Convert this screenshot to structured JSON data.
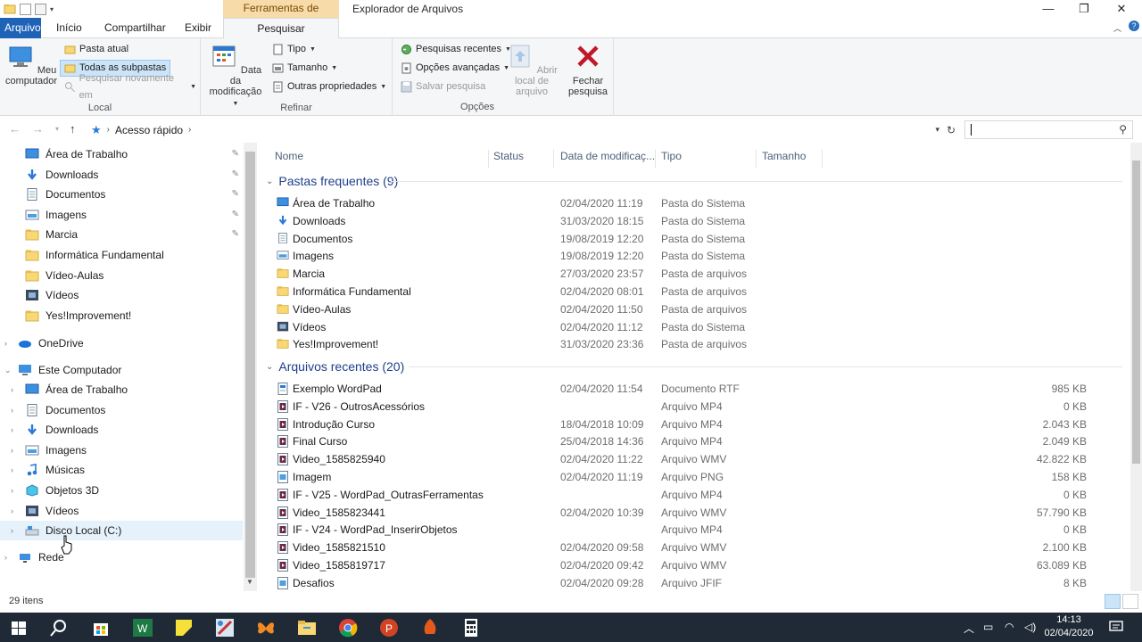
{
  "window": {
    "title": "Explorador de Arquivos",
    "context_tab": "Ferramentas de Pesquisa",
    "minimize": "—",
    "maximize": "❐",
    "close": "✕"
  },
  "tabs": [
    {
      "label": "Arquivo"
    },
    {
      "label": "Início"
    },
    {
      "label": "Compartilhar"
    },
    {
      "label": "Exibir"
    },
    {
      "label": "Pesquisar"
    }
  ],
  "ribbon": {
    "local": {
      "label": "Local",
      "computer": "Meu computador",
      "current_folder": "Pasta atual",
      "all_subfolders": "Todas as subpastas",
      "search_again": "Pesquisar novamente em"
    },
    "refine": {
      "label": "Refinar",
      "date_modified": "Data da modificação",
      "type": "Tipo",
      "size": "Tamanho",
      "other_props": "Outras propriedades"
    },
    "options": {
      "label": "Opções",
      "recent_searches": "Pesquisas recentes",
      "advanced": "Opções avançadas",
      "save_search": "Salvar pesquisa",
      "open_location": "Abrir local de arquivo",
      "close_search": "Fechar pesquisa"
    }
  },
  "address": {
    "path": "Acesso rápido",
    "search_placeholder": ""
  },
  "nav": {
    "quick_access": [
      {
        "label": "Área de Trabalho",
        "icon": "desktop-icon",
        "pinned": true
      },
      {
        "label": "Downloads",
        "icon": "download-icon",
        "pinned": true
      },
      {
        "label": "Documentos",
        "icon": "document-icon",
        "pinned": true
      },
      {
        "label": "Imagens",
        "icon": "image-icon",
        "pinned": true
      },
      {
        "label": "Marcia",
        "icon": "folder-icon",
        "pinned": true
      },
      {
        "label": "Informática Fundamental",
        "icon": "folder-icon",
        "pinned": false
      },
      {
        "label": "Vídeo-Aulas",
        "icon": "folder-icon",
        "pinned": false
      },
      {
        "label": "Vídeos",
        "icon": "video-icon",
        "pinned": false
      },
      {
        "label": "Yes!Improvement!",
        "icon": "folder-icon",
        "pinned": false
      }
    ],
    "onedrive": "OneDrive",
    "this_pc": "Este Computador",
    "pc_items": [
      {
        "label": "Área de Trabalho",
        "icon": "desktop-icon"
      },
      {
        "label": "Documentos",
        "icon": "document-icon"
      },
      {
        "label": "Downloads",
        "icon": "download-icon"
      },
      {
        "label": "Imagens",
        "icon": "image-icon"
      },
      {
        "label": "Músicas",
        "icon": "music-icon"
      },
      {
        "label": "Objetos 3D",
        "icon": "3d-icon"
      },
      {
        "label": "Vídeos",
        "icon": "video-icon"
      },
      {
        "label": "Disco Local (C:)",
        "icon": "drive-icon"
      }
    ],
    "network": "Rede"
  },
  "columns": {
    "name": "Nome",
    "status": "Status",
    "date": "Data de modificaç...",
    "type": "Tipo",
    "size": "Tamanho"
  },
  "groups": {
    "frequent": "Pastas frequentes (9)",
    "recent": "Arquivos recentes (20)"
  },
  "frequent_folders": [
    {
      "name": "Área de Trabalho",
      "date": "02/04/2020 11:19",
      "type": "Pasta do Sistema",
      "icon": "desktop-icon"
    },
    {
      "name": "Downloads",
      "date": "31/03/2020 18:15",
      "type": "Pasta do Sistema",
      "icon": "download-icon"
    },
    {
      "name": "Documentos",
      "date": "19/08/2019 12:20",
      "type": "Pasta do Sistema",
      "icon": "document-icon"
    },
    {
      "name": "Imagens",
      "date": "19/08/2019 12:20",
      "type": "Pasta do Sistema",
      "icon": "image-icon"
    },
    {
      "name": "Marcia",
      "date": "27/03/2020 23:57",
      "type": "Pasta de arquivos",
      "icon": "folder-icon"
    },
    {
      "name": "Informática Fundamental",
      "date": "02/04/2020 08:01",
      "type": "Pasta de arquivos",
      "icon": "folder-icon"
    },
    {
      "name": "Vídeo-Aulas",
      "date": "02/04/2020 11:50",
      "type": "Pasta de arquivos",
      "icon": "folder-icon"
    },
    {
      "name": "Vídeos",
      "date": "02/04/2020 11:12",
      "type": "Pasta do Sistema",
      "icon": "video-icon"
    },
    {
      "name": "Yes!Improvement!",
      "date": "31/03/2020 23:36",
      "type": "Pasta de arquivos",
      "icon": "folder-icon"
    }
  ],
  "recent_files": [
    {
      "name": "Exemplo WordPad",
      "date": "02/04/2020 11:54",
      "type": "Documento RTF",
      "size": "985 KB",
      "icon": "rtf-icon"
    },
    {
      "name": "IF - V26 - OutrosAcessórios",
      "date": "",
      "type": "Arquivo MP4",
      "size": "0 KB",
      "icon": "media-icon"
    },
    {
      "name": "Introdução Curso",
      "date": "18/04/2018 10:09",
      "type": "Arquivo MP4",
      "size": "2.043 KB",
      "icon": "media-icon"
    },
    {
      "name": "Final Curso",
      "date": "25/04/2018 14:36",
      "type": "Arquivo MP4",
      "size": "2.049 KB",
      "icon": "media-icon"
    },
    {
      "name": "Video_1585825940",
      "date": "02/04/2020 11:22",
      "type": "Arquivo WMV",
      "size": "42.822 KB",
      "icon": "media-icon"
    },
    {
      "name": "Imagem",
      "date": "02/04/2020 11:19",
      "type": "Arquivo PNG",
      "size": "158 KB",
      "icon": "png-icon"
    },
    {
      "name": "IF - V25 - WordPad_OutrasFerramentas",
      "date": "",
      "type": "Arquivo MP4",
      "size": "0 KB",
      "icon": "media-icon"
    },
    {
      "name": "Video_1585823441",
      "date": "02/04/2020 10:39",
      "type": "Arquivo WMV",
      "size": "57.790 KB",
      "icon": "media-icon"
    },
    {
      "name": "IF - V24 - WordPad_InserirObjetos",
      "date": "",
      "type": "Arquivo MP4",
      "size": "0 KB",
      "icon": "media-icon"
    },
    {
      "name": "Video_1585821510",
      "date": "02/04/2020 09:58",
      "type": "Arquivo WMV",
      "size": "2.100 KB",
      "icon": "media-icon"
    },
    {
      "name": "Video_1585819717",
      "date": "02/04/2020 09:42",
      "type": "Arquivo WMV",
      "size": "63.089 KB",
      "icon": "media-icon"
    },
    {
      "name": "Desafios",
      "date": "02/04/2020 09:28",
      "type": "Arquivo JFIF",
      "size": "8 KB",
      "icon": "png-icon"
    }
  ],
  "status": {
    "count": "29 itens"
  },
  "taskbar": {
    "apps": [
      "start-icon",
      "search-icon",
      "store-icon",
      "excel-icon",
      "sticky-notes-icon",
      "paint-icon",
      "butterfly-icon",
      "file-explorer-icon",
      "chrome-icon",
      "powerpoint-icon",
      "app-icon",
      "calculator-icon"
    ],
    "time": "14:13",
    "date": "02/04/2020"
  },
  "colors": {
    "accent": "#1e63b8",
    "context_tab": "#f7dcaa",
    "group_header": "#1e3f8a",
    "taskbar": "#1f2a36",
    "folder": "#f8d775"
  }
}
